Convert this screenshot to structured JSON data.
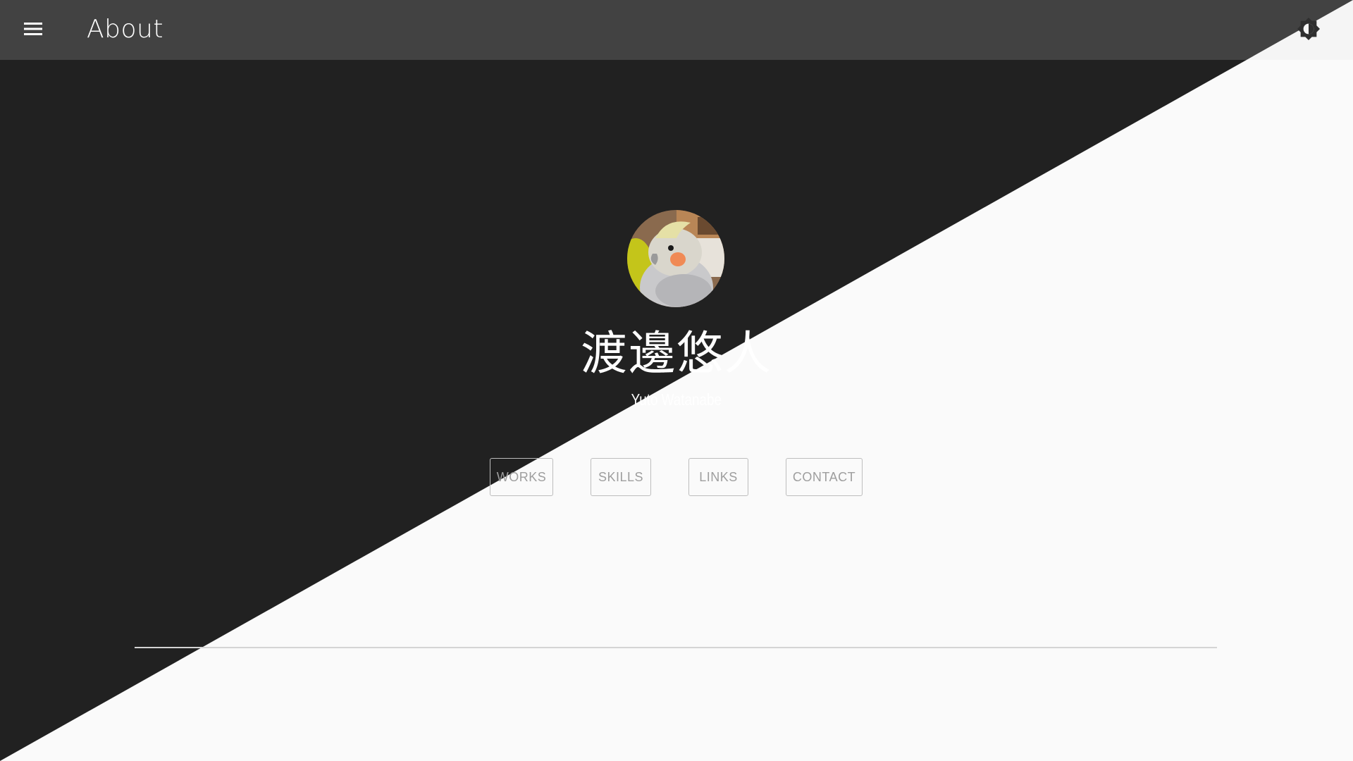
{
  "app_bar": {
    "title": "About",
    "background_color": "#424242",
    "title_color": "#ffffff",
    "menu_icon": "menu-icon",
    "theme_icon": "brightness-auto-icon"
  },
  "background": {
    "dark_color": "#212121",
    "light_color": "#fafafa"
  },
  "profile": {
    "avatar_alt": "cockatiel-photo",
    "name_ja": "渡邊悠人",
    "name_en": "Yuto Watanabe"
  },
  "nav": {
    "works": "WORKS",
    "skills": "SKILLS",
    "links": "LINKS",
    "contact": "CONTACT"
  }
}
